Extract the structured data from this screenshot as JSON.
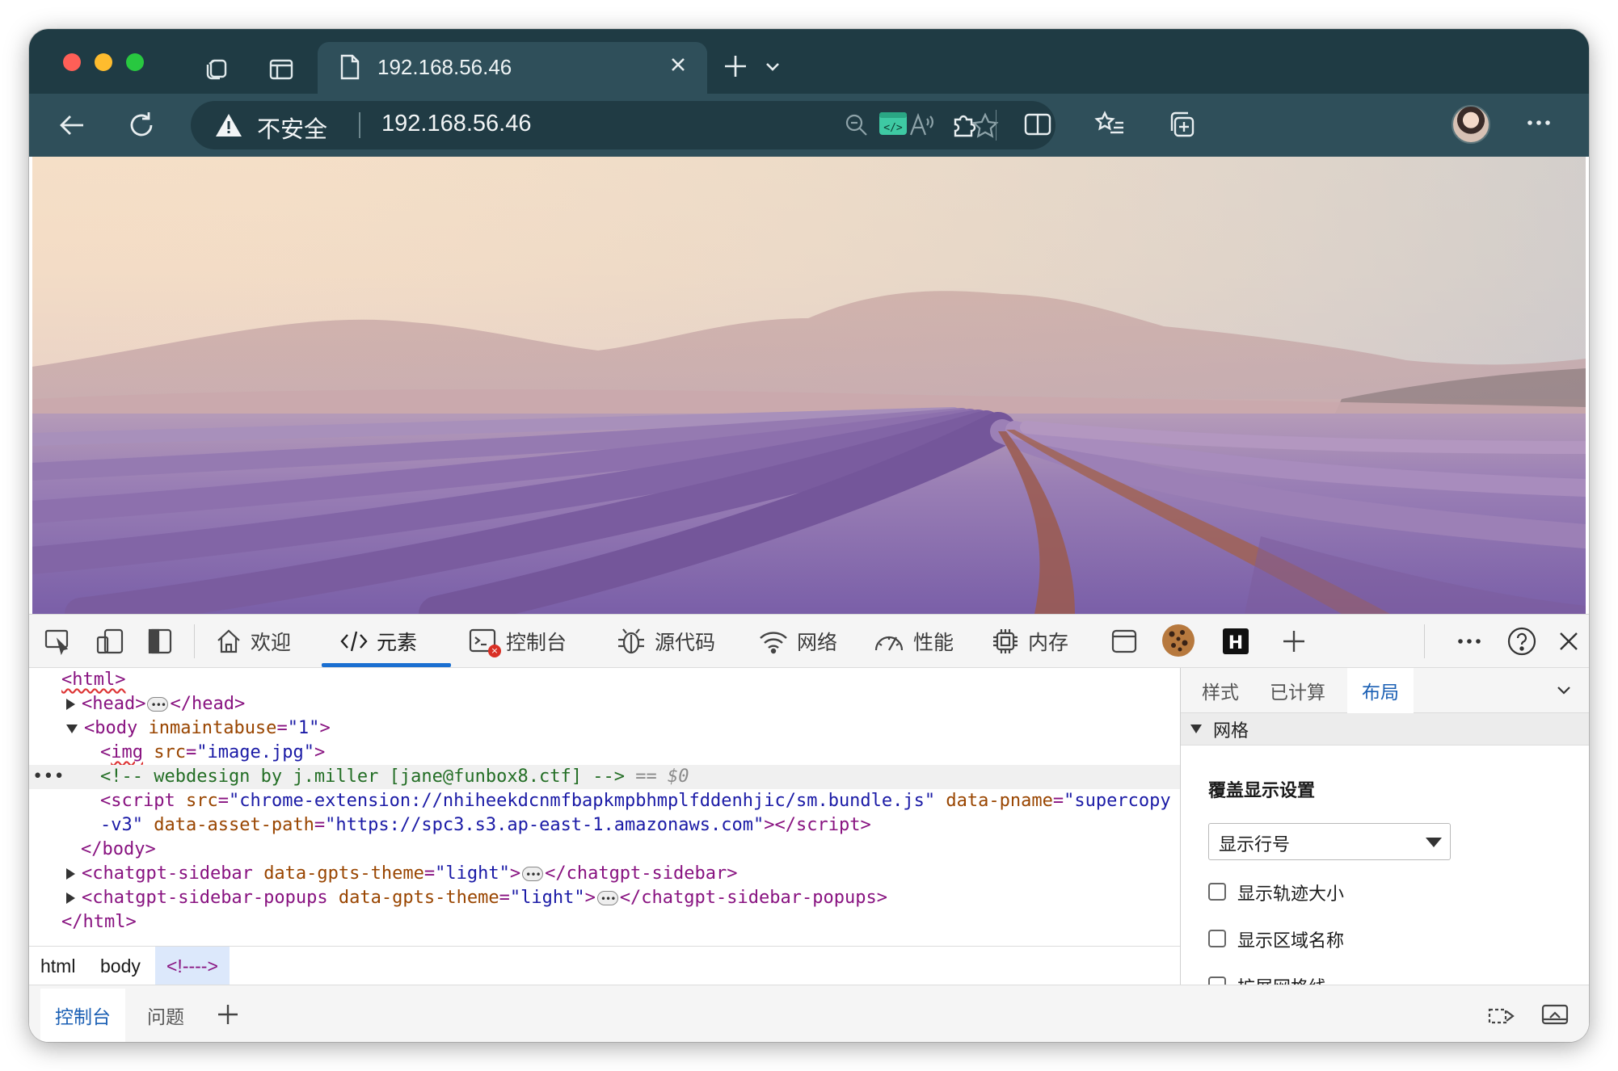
{
  "browser": {
    "tab_title": "192.168.56.46",
    "security_label": "不安全",
    "url": "192.168.56.46"
  },
  "devtools": {
    "tabs": {
      "welcome": "欢迎",
      "elements": "元素",
      "console": "控制台",
      "sources": "源代码",
      "network": "网络",
      "performance": "性能",
      "memory": "内存"
    },
    "dom": {
      "html_open": "<html>",
      "head_open": "<head>",
      "head_close": "</head>",
      "body_tag": "body",
      "body_attr": "inmaintabuse",
      "body_val": "\"1\"",
      "img_tag": "img",
      "img_attr": "src",
      "img_val": "\"image.jpg\"",
      "comment": "<!-- webdesign by j.miller [jane@funbox8.ctf] -->",
      "eq_marker": "== $0",
      "script_attr1": "src",
      "script_val1": "\"chrome-extension://nhiheekdcnmfbapkmpbhmplfddenhjic/sm.bundle.js\"",
      "script_attr2": "data-pname",
      "script_val2_a": "\"supercopy",
      "script_val2_b": "-v3\"",
      "script_attr3": "data-asset-path",
      "script_val3": "\"https://spc3.s3.ap-east-1.amazonaws.com\"",
      "body_close": "</body>",
      "sidebar_tag": "chatgpt-sidebar",
      "sidebar_attr": "data-gpts-theme",
      "sidebar_val": "\"light\"",
      "sidebar_close": "</chatgpt-sidebar>",
      "popups_tag": "chatgpt-sidebar-popups",
      "popups_attr": "data-gpts-theme",
      "popups_val": "\"light\"",
      "popups_close": "</chatgpt-sidebar-popups>",
      "html_close": "</html>"
    },
    "breadcrumb": [
      "html",
      "body",
      "<!---->"
    ],
    "right_pane": {
      "tabs": [
        "样式",
        "已计算",
        "布局"
      ],
      "section": "网格",
      "overlay_title": "覆盖显示设置",
      "select_value": "显示行号",
      "checks": [
        "显示轨迹大小",
        "显示区域名称",
        "扩展网格线"
      ]
    },
    "drawer": {
      "tabs": [
        "控制台",
        "问题"
      ]
    }
  }
}
